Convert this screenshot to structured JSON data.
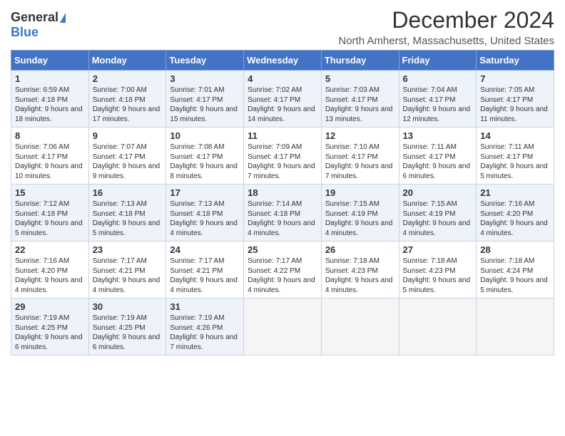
{
  "logo": {
    "general": "General",
    "blue": "Blue"
  },
  "title": "December 2024",
  "subtitle": "North Amherst, Massachusetts, United States",
  "days_header": [
    "Sunday",
    "Monday",
    "Tuesday",
    "Wednesday",
    "Thursday",
    "Friday",
    "Saturday"
  ],
  "weeks": [
    [
      {
        "day": "1",
        "info": "Sunrise: 6:59 AM\nSunset: 4:18 PM\nDaylight: 9 hours and 18 minutes."
      },
      {
        "day": "2",
        "info": "Sunrise: 7:00 AM\nSunset: 4:18 PM\nDaylight: 9 hours and 17 minutes."
      },
      {
        "day": "3",
        "info": "Sunrise: 7:01 AM\nSunset: 4:17 PM\nDaylight: 9 hours and 15 minutes."
      },
      {
        "day": "4",
        "info": "Sunrise: 7:02 AM\nSunset: 4:17 PM\nDaylight: 9 hours and 14 minutes."
      },
      {
        "day": "5",
        "info": "Sunrise: 7:03 AM\nSunset: 4:17 PM\nDaylight: 9 hours and 13 minutes."
      },
      {
        "day": "6",
        "info": "Sunrise: 7:04 AM\nSunset: 4:17 PM\nDaylight: 9 hours and 12 minutes."
      },
      {
        "day": "7",
        "info": "Sunrise: 7:05 AM\nSunset: 4:17 PM\nDaylight: 9 hours and 11 minutes."
      }
    ],
    [
      {
        "day": "8",
        "info": "Sunrise: 7:06 AM\nSunset: 4:17 PM\nDaylight: 9 hours and 10 minutes."
      },
      {
        "day": "9",
        "info": "Sunrise: 7:07 AM\nSunset: 4:17 PM\nDaylight: 9 hours and 9 minutes."
      },
      {
        "day": "10",
        "info": "Sunrise: 7:08 AM\nSunset: 4:17 PM\nDaylight: 9 hours and 8 minutes."
      },
      {
        "day": "11",
        "info": "Sunrise: 7:09 AM\nSunset: 4:17 PM\nDaylight: 9 hours and 7 minutes."
      },
      {
        "day": "12",
        "info": "Sunrise: 7:10 AM\nSunset: 4:17 PM\nDaylight: 9 hours and 7 minutes."
      },
      {
        "day": "13",
        "info": "Sunrise: 7:11 AM\nSunset: 4:17 PM\nDaylight: 9 hours and 6 minutes."
      },
      {
        "day": "14",
        "info": "Sunrise: 7:11 AM\nSunset: 4:17 PM\nDaylight: 9 hours and 5 minutes."
      }
    ],
    [
      {
        "day": "15",
        "info": "Sunrise: 7:12 AM\nSunset: 4:18 PM\nDaylight: 9 hours and 5 minutes."
      },
      {
        "day": "16",
        "info": "Sunrise: 7:13 AM\nSunset: 4:18 PM\nDaylight: 9 hours and 5 minutes."
      },
      {
        "day": "17",
        "info": "Sunrise: 7:13 AM\nSunset: 4:18 PM\nDaylight: 9 hours and 4 minutes."
      },
      {
        "day": "18",
        "info": "Sunrise: 7:14 AM\nSunset: 4:18 PM\nDaylight: 9 hours and 4 minutes."
      },
      {
        "day": "19",
        "info": "Sunrise: 7:15 AM\nSunset: 4:19 PM\nDaylight: 9 hours and 4 minutes."
      },
      {
        "day": "20",
        "info": "Sunrise: 7:15 AM\nSunset: 4:19 PM\nDaylight: 9 hours and 4 minutes."
      },
      {
        "day": "21",
        "info": "Sunrise: 7:16 AM\nSunset: 4:20 PM\nDaylight: 9 hours and 4 minutes."
      }
    ],
    [
      {
        "day": "22",
        "info": "Sunrise: 7:16 AM\nSunset: 4:20 PM\nDaylight: 9 hours and 4 minutes."
      },
      {
        "day": "23",
        "info": "Sunrise: 7:17 AM\nSunset: 4:21 PM\nDaylight: 9 hours and 4 minutes."
      },
      {
        "day": "24",
        "info": "Sunrise: 7:17 AM\nSunset: 4:21 PM\nDaylight: 9 hours and 4 minutes."
      },
      {
        "day": "25",
        "info": "Sunrise: 7:17 AM\nSunset: 4:22 PM\nDaylight: 9 hours and 4 minutes."
      },
      {
        "day": "26",
        "info": "Sunrise: 7:18 AM\nSunset: 4:23 PM\nDaylight: 9 hours and 4 minutes."
      },
      {
        "day": "27",
        "info": "Sunrise: 7:18 AM\nSunset: 4:23 PM\nDaylight: 9 hours and 5 minutes."
      },
      {
        "day": "28",
        "info": "Sunrise: 7:18 AM\nSunset: 4:24 PM\nDaylight: 9 hours and 5 minutes."
      }
    ],
    [
      {
        "day": "29",
        "info": "Sunrise: 7:19 AM\nSunset: 4:25 PM\nDaylight: 9 hours and 6 minutes."
      },
      {
        "day": "30",
        "info": "Sunrise: 7:19 AM\nSunset: 4:25 PM\nDaylight: 9 hours and 6 minutes."
      },
      {
        "day": "31",
        "info": "Sunrise: 7:19 AM\nSunset: 4:26 PM\nDaylight: 9 hours and 7 minutes."
      },
      null,
      null,
      null,
      null
    ]
  ]
}
